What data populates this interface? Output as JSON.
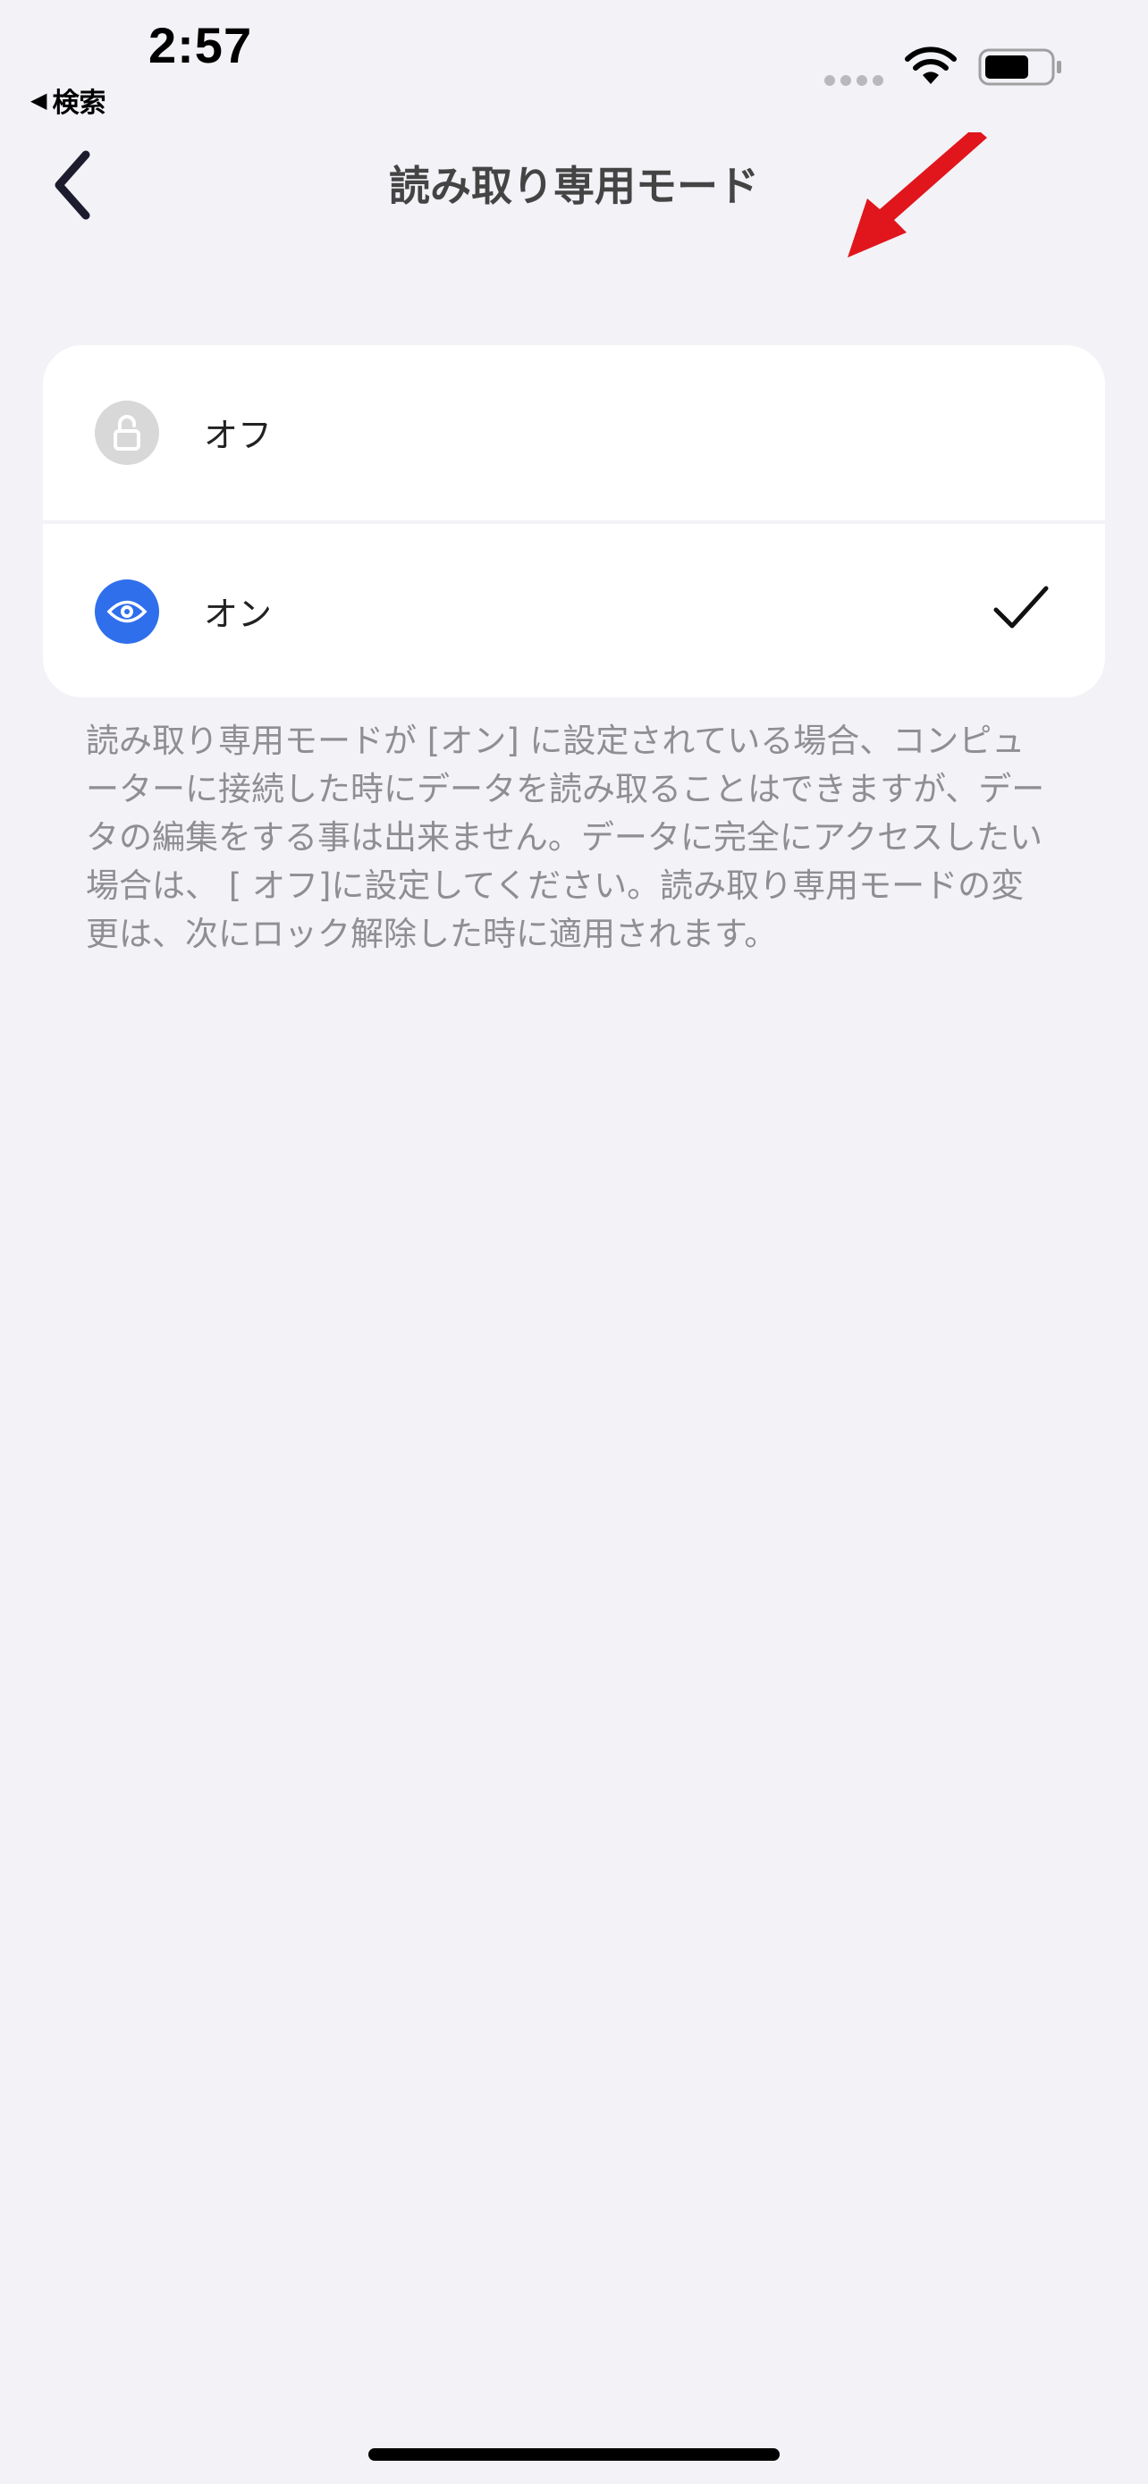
{
  "status_bar": {
    "time": "2:57",
    "back_app_label": "検索",
    "back_app_arrow": "◀",
    "icons": [
      "signal-dots",
      "wifi-icon",
      "battery-icon"
    ]
  },
  "nav": {
    "title": "読み取り専用モード",
    "back_icon": "chevron-left-icon"
  },
  "annotation": {
    "icon": "red-arrow-icon",
    "color": "#e0161c"
  },
  "options": {
    "off": {
      "label": "オフ",
      "icon": "unlock-icon",
      "icon_bg": "#d8d8d8",
      "selected": false
    },
    "on": {
      "label": "オン",
      "icon": "eye-icon",
      "icon_bg": "#2f6fec",
      "selected": true
    }
  },
  "description": "読み取り専用モードが [オン] に設定されている場合、コンピューターに接続した時にデータを読み取ることはできますが、データの編集をする事は出来ません。データに完全にアクセスしたい場合は、 [ オフ]に設定してください。読み取り専用モードの変更は、次にロック解除した時に適用されます。",
  "colors": {
    "background": "#f2f2f7",
    "card": "#ffffff",
    "secondary_text": "#8e8e93",
    "accent": "#2f6fec"
  }
}
